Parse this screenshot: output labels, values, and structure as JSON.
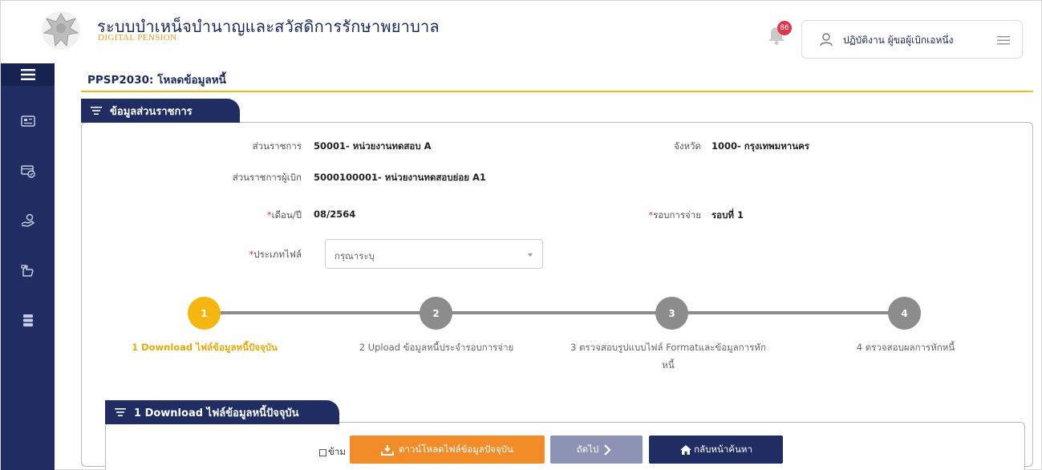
{
  "header": {
    "title": "ระบบบำเหน็จบำนาญและสวัสดิการรักษาพยาบาล",
    "subtitle": "DIGITAL PENSION",
    "notification_count": "86",
    "user_name": "ปฏิบัติงาน ผู้ขอผู้เบิกเอหนึ่ง"
  },
  "sidebar": {
    "items": [
      "menu-icon",
      "card-icon",
      "ticket-icon",
      "money-hand-icon",
      "hand-coin-icon",
      "stack-icon"
    ]
  },
  "page": {
    "title": "PPSP2030: โหลดข้อมูลหนี้"
  },
  "section1": {
    "tab_label": "ข้อมูลส่วนราชการ",
    "fields": {
      "agency_label": "ส่วนราชการ",
      "agency_value": "50001- หน่วยงานทดสอบ A",
      "province_label": "จังหวัด",
      "province_value": "1000- กรุงเทพมหานคร",
      "disbursing_label": "ส่วนราชการผู้เบิก",
      "disbursing_value": "5000100001- หน่วยงานทดสอบย่อย A1",
      "required_mark": "*",
      "month_label": "เดือน/ปี",
      "month_value": "08/2564",
      "round_label": "รอบการจ่าย",
      "round_value": "รอบที่ 1",
      "filetype_label": "ประเภทไฟล์",
      "filetype_placeholder": "กรุณาระบุ"
    }
  },
  "stepper": {
    "steps": [
      {
        "number": "1",
        "label": "1 Download ไฟล์ข้อมูลหนี้ปัจจุบัน",
        "active": true
      },
      {
        "number": "2",
        "label": "2 Upload ข้อมูลหนี้ประจำรอบการจ่าย",
        "active": false
      },
      {
        "number": "3",
        "label_line1": "3 ตรวจสอบรูปแบบไฟล์ Formatและข้อมูลการหัก",
        "label_line2": "หนี้",
        "active": false
      },
      {
        "number": "4",
        "label": "4 ตรวจสอบผลการหักหนี้",
        "active": false
      }
    ]
  },
  "section2": {
    "tab_label": "1 Download ไฟล์ข้อมูลหนี้ปัจจุบัน",
    "skip_label": "ข้าม",
    "download_button": "ดาวน์โหลดไฟล์ข้อมูลปัจจุบัน",
    "next_button": "ถัดไป",
    "back_button": "กลับหน้าค้นหา"
  },
  "colors": {
    "navy": "#1f2d62",
    "gold": "#f5b70f",
    "orange_button": "#f28c28",
    "gray_button": "#8c93b5",
    "required": "#e0364b"
  }
}
